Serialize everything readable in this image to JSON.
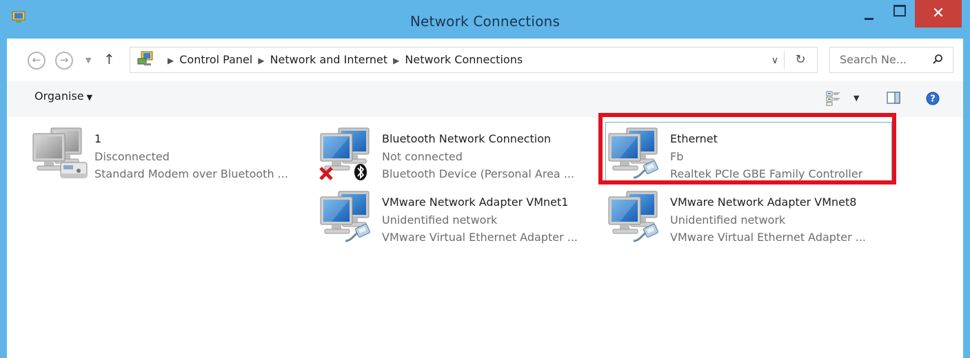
{
  "window": {
    "title": "Network Connections"
  },
  "address": {
    "breadcrumbs": [
      "Control Panel",
      "Network and Internet",
      "Network Connections"
    ],
    "search_placeholder": "Search Ne..."
  },
  "command_bar": {
    "organise_label": "Organise"
  },
  "connections": [
    {
      "name": "1",
      "status": "Disconnected",
      "device": "Standard Modem over Bluetooth ...",
      "kind": "modem"
    },
    {
      "name": "Bluetooth Network Connection",
      "status": "Not connected",
      "device": "Bluetooth Device (Personal Area ...",
      "kind": "bluetooth"
    },
    {
      "name": "Ethernet",
      "status": "Fb",
      "device": "Realtek PCIe GBE Family Controller",
      "kind": "ethernet",
      "selected": true
    },
    {
      "name": "VMware Network Adapter VMnet1",
      "status": "Unidentified network",
      "device": "VMware Virtual Ethernet Adapter ...",
      "kind": "ethernet"
    },
    {
      "name": "VMware Network Adapter VMnet8",
      "status": "Unidentified network",
      "device": "VMware Virtual Ethernet Adapter ...",
      "kind": "ethernet"
    }
  ],
  "colors": {
    "titlebar": "#5fb5e8",
    "close": "#c7403a",
    "highlight": "#e3101e",
    "selection": "#7aa7d6"
  },
  "icons": [
    "app-icon",
    "back-icon",
    "forward-icon",
    "up-arrow-icon",
    "network-folder-icon",
    "refresh-icon",
    "search-icon",
    "view-options-icon",
    "preview-pane-icon",
    "help-icon",
    "network-computer-icon",
    "modem-icon",
    "bluetooth-icon",
    "red-x-icon",
    "ethernet-cable-icon"
  ]
}
